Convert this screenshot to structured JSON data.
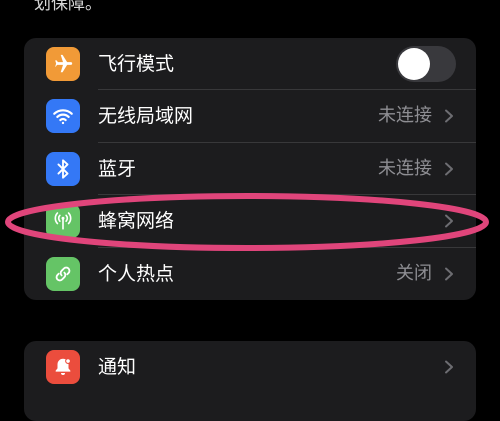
{
  "top": {
    "partial_text": "划保障。"
  },
  "colors": {
    "airplane": "#f19a37",
    "wifi": "#3478f6",
    "bluetooth": "#3478f6",
    "cellular": "#65c466",
    "hotspot": "#65c466",
    "notifications": "#eb4d3d",
    "highlight": "#e0457b"
  },
  "group1": {
    "rows": [
      {
        "label": "飞行模式",
        "icon": "airplane-icon",
        "toggle_on": false
      },
      {
        "label": "无线局域网",
        "value": "未连接",
        "icon": "wifi-icon"
      },
      {
        "label": "蓝牙",
        "value": "未连接",
        "icon": "bluetooth-icon"
      },
      {
        "label": "蜂窝网络",
        "icon": "cellular-icon"
      },
      {
        "label": "个人热点",
        "value": "关闭",
        "icon": "hotspot-icon"
      }
    ]
  },
  "group2": {
    "rows": [
      {
        "label": "通知",
        "icon": "bell-icon"
      }
    ]
  }
}
